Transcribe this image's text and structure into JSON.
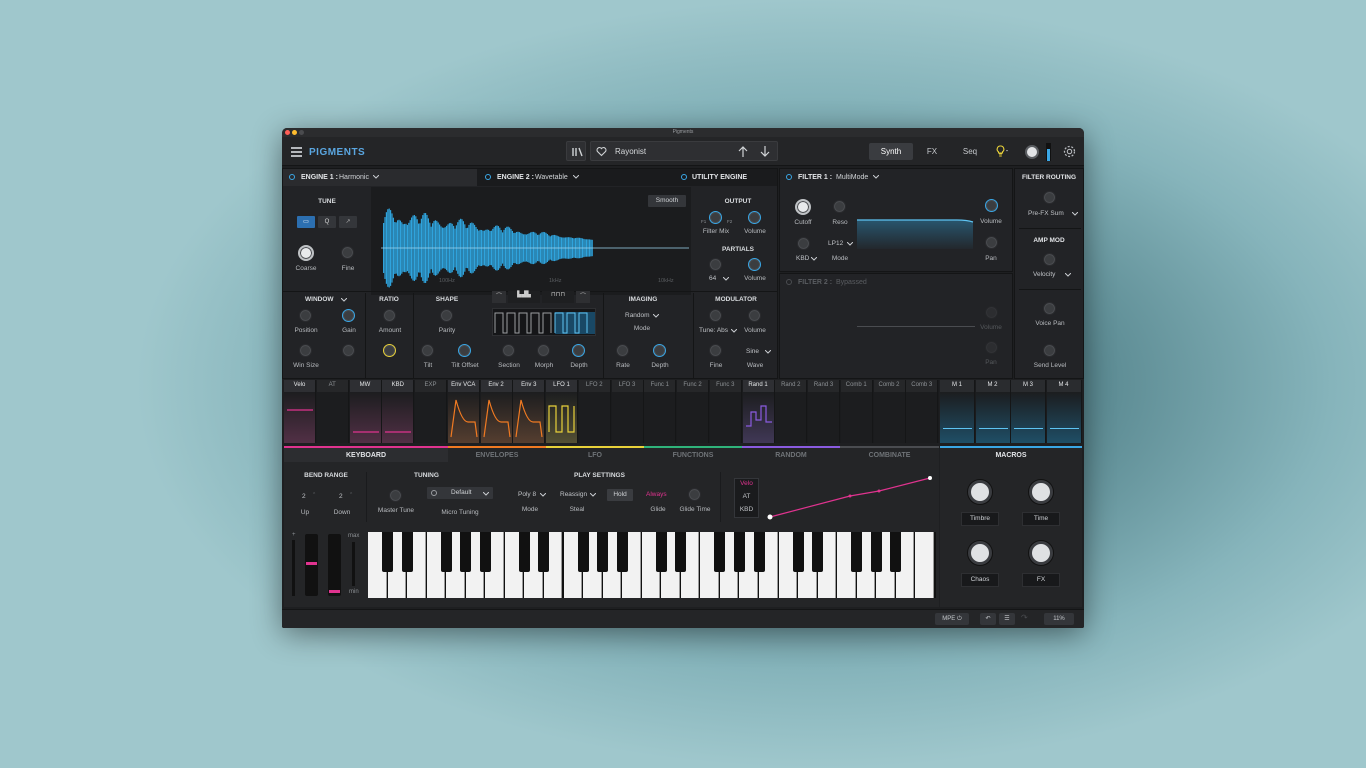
{
  "window": {
    "title": "Pigments"
  },
  "app": {
    "logo": "PIGMENTS"
  },
  "preset": {
    "name": "Rayonist"
  },
  "tabs": [
    "Synth",
    "FX",
    "Seq"
  ],
  "engine1": {
    "label": "ENGINE 1 :",
    "type": "Harmonic"
  },
  "engine2": {
    "label": "ENGINE 2 :",
    "type": "Wavetable"
  },
  "utility": {
    "label": "UTILITY ENGINE"
  },
  "tune": {
    "title": "TUNE",
    "mode_buttons": [
      "Q"
    ],
    "coarse": "Coarse",
    "fine": "Fine"
  },
  "window_sec": {
    "title": "WINDOW",
    "position": "Position",
    "gain": "Gain",
    "win_size": "Win Size"
  },
  "ratio": {
    "title": "RATIO",
    "amount": "Amount"
  },
  "shape": {
    "title": "SHAPE",
    "parity": "Parity",
    "tilt": "Tilt",
    "tilt_offset": "Tilt Offset",
    "section": "Section",
    "morph": "Morph",
    "depth": "Depth"
  },
  "imaging": {
    "title": "IMAGING",
    "mode_value": "Random",
    "mode": "Mode",
    "rate": "Rate",
    "depth": "Depth"
  },
  "output": {
    "title": "OUTPUT",
    "filter_mix": "Filter Mix",
    "volume": "Volume",
    "f1": "F1",
    "f2": "F2"
  },
  "partials": {
    "title": "PARTIALS",
    "value": "64",
    "volume": "Volume"
  },
  "modulator": {
    "title": "MODULATOR",
    "tune_value": "Tune: Abs",
    "volume": "Volume",
    "fine": "Fine",
    "wave_value": "Sine",
    "wave": "Wave"
  },
  "wave_display": {
    "smooth": "Smooth",
    "axis": [
      "100Hz",
      "1kHz",
      "10kHz"
    ]
  },
  "filter1": {
    "label": "FILTER 1 :",
    "type": "MultiMode",
    "cutoff": "Cutoff",
    "reso": "Reso",
    "volume": "Volume",
    "kbd": "KBD",
    "mode_value": "LP12",
    "mode": "Mode",
    "pan": "Pan"
  },
  "filter2": {
    "label": "FILTER 2 :",
    "type": "Bypassed",
    "volume": "Volume",
    "pan": "Pan"
  },
  "filter_routing": {
    "title": "FILTER ROUTING",
    "value": "Pre-FX Sum",
    "amp_mod": "AMP MOD",
    "amp_value": "Velocity",
    "voice_pan": "Voice Pan",
    "send_level": "Send Level"
  },
  "mod_sources": [
    "Velo",
    "AT",
    "MW",
    "KBD",
    "EXP",
    "Env VCA",
    "Env 2",
    "Env 3",
    "LFO 1",
    "LFO 2",
    "LFO 3",
    "Func 1",
    "Func 2",
    "Func 3",
    "Rand 1",
    "Rand 2",
    "Rand 3",
    "Comb 1",
    "Comb 2",
    "Comb 3"
  ],
  "macros_sources": [
    "M 1",
    "M 2",
    "M 3",
    "M 4"
  ],
  "bottom_tabs": [
    "KEYBOARD",
    "ENVELOPES",
    "LFO",
    "FUNCTIONS",
    "RANDOM",
    "COMBINATE"
  ],
  "keyboard": {
    "bend_range": "BEND RANGE",
    "up_value": "2",
    "up": "Up",
    "down_value": "2",
    "down": "Down",
    "tuning": "TUNING",
    "master_tune": "Master Tune",
    "micro_value": "Default",
    "micro_tuning": "Micro Tuning",
    "play_settings": "PLAY SETTINGS",
    "poly_value": "Poly 8",
    "mode": "Mode",
    "reassign_value": "Reassign",
    "steal": "Steal",
    "hold": "Hold",
    "always": "Always",
    "glide": "Glide",
    "glide_time": "Glide Time",
    "vel_options": [
      "Velo",
      "AT",
      "KBD"
    ],
    "max": "max",
    "min": "min",
    "plus": "+",
    "minus": "-"
  },
  "macros": {
    "title": "MACROS",
    "items": [
      "Timbre",
      "Time",
      "Chaos",
      "FX"
    ]
  },
  "bottombar": {
    "mpe": "MPE",
    "zoom": "11%"
  },
  "colors": {
    "accent": "#3aa7e6",
    "env": "#f07a22",
    "lfo": "#e8d13a",
    "rand": "#8a5be0",
    "velo": "#e0338f",
    "macro": "#3aa7e6"
  }
}
